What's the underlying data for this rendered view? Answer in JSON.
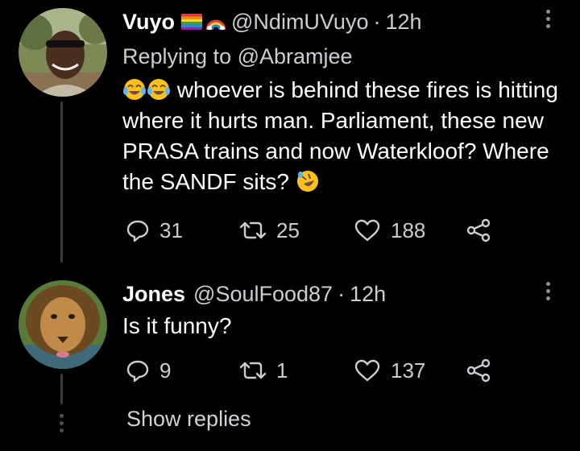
{
  "tweets": [
    {
      "name": "Vuyo",
      "handle": "@NdimUVuyo",
      "separator": "·",
      "time": "12h",
      "replying_prefix": "Replying to",
      "replying_to": "@Abramjee",
      "body": "whoever is behind these fires is hitting where it hurts man. Parliament, these new PRASA trains and now Waterkloof? Where the SANDF sits?",
      "reply_count": "31",
      "retweet_count": "25",
      "like_count": "188"
    },
    {
      "name": "Jones",
      "handle": "@SoulFood87",
      "separator": "·",
      "time": "12h",
      "body": "Is it funny?",
      "reply_count": "9",
      "retweet_count": "1",
      "like_count": "137"
    }
  ],
  "show_replies_label": "Show replies",
  "icons": {
    "reply": "reply-icon",
    "retweet": "retweet-icon",
    "like": "heart-icon",
    "share": "share-icon",
    "more": "more-options-icon",
    "flags": [
      "rainbow-flag-icon",
      "rainbow-icon"
    ],
    "emoji": "face-with-tears-of-joy-emoji"
  },
  "colors": {
    "background": "#000000",
    "text": "#ffffff",
    "secondary_text": "#c9ced3",
    "thread_line": "#3a3d40"
  }
}
